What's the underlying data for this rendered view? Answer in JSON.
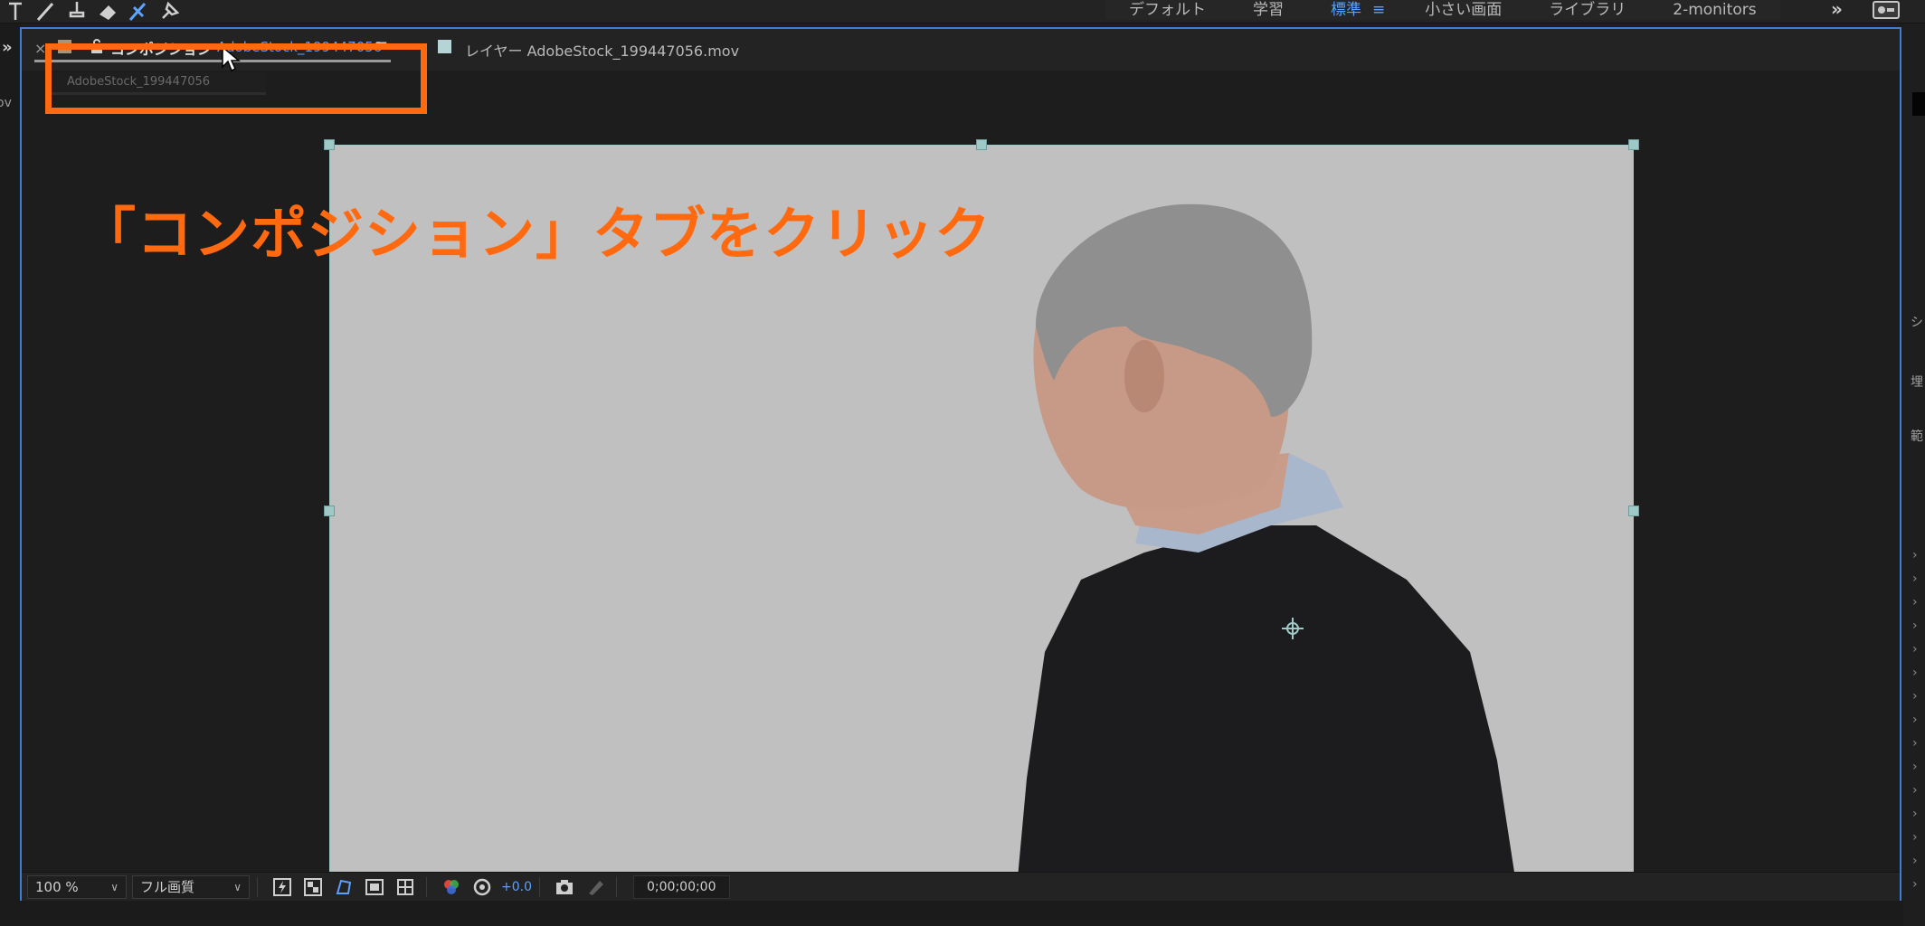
{
  "workspace": {
    "items": [
      {
        "label": "デフォルト",
        "active": false
      },
      {
        "label": "学習",
        "active": false
      },
      {
        "label": "標準",
        "active": true
      },
      {
        "label": "小さい画面",
        "active": false
      },
      {
        "label": "ライブラリ",
        "active": false
      },
      {
        "label": "2-monitors",
        "active": false
      }
    ],
    "menu_glyph": "≡",
    "overflow_glyph": "»"
  },
  "left_strip": {
    "expand_glyph": "»",
    "fragment": "ov"
  },
  "composition_panel": {
    "tab": {
      "close_glyph": "×",
      "title": "コンポジション",
      "name": "AdobeStock_199447056",
      "menu_glyph": "≡",
      "swatch_color": "#a8947a"
    },
    "layer_tab": {
      "title": "レイヤー AdobeStock_199447056.mov",
      "swatch_color": "#b6d4d6"
    },
    "subtab": "AdobeStock_199447056"
  },
  "annotation": {
    "text": "「コンポジション」タブをクリック",
    "color": "#ff6a10"
  },
  "canvas": {
    "background": "#c0c0c0",
    "handle_color": "#9ec9c7"
  },
  "bottom_toolbar": {
    "zoom": "100 %",
    "resolution": "フル画質",
    "exposure": "+0.0",
    "timecode": "0;00;00;00"
  },
  "right_panel": {
    "labels": [
      "シ",
      "埋",
      "範"
    ]
  },
  "colors": {
    "accent": "#5aa0ff",
    "panel_border": "#3e7dd6",
    "highlight": "#ff6a10"
  }
}
